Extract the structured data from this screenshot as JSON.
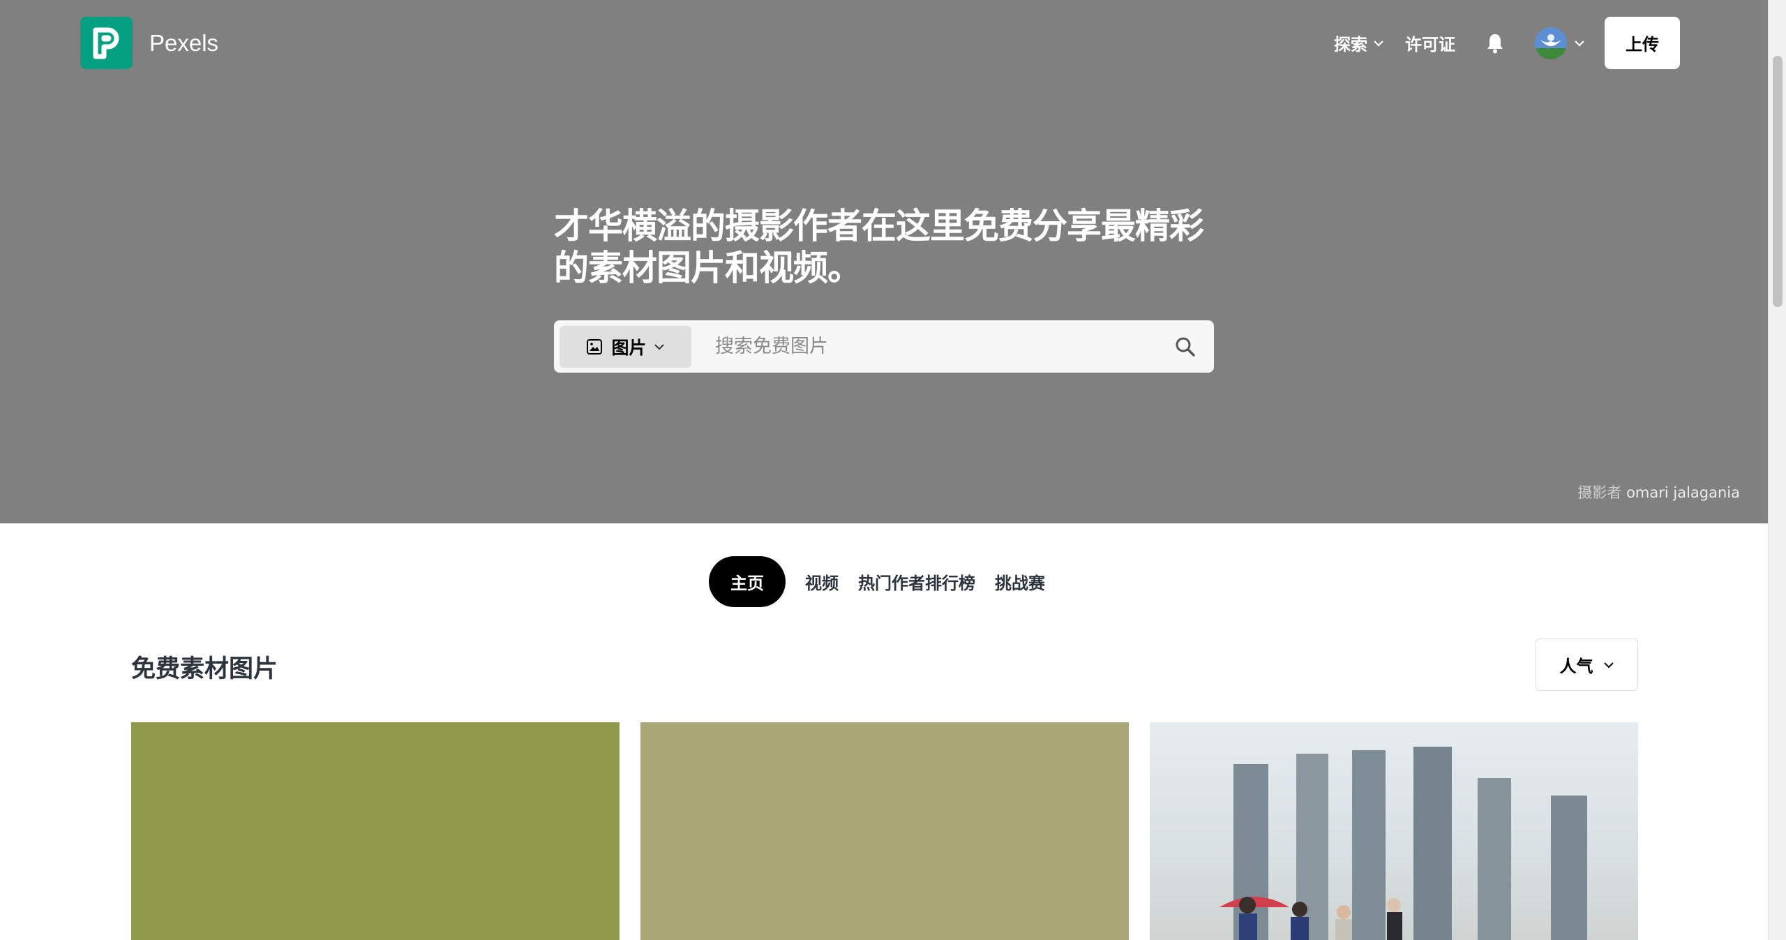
{
  "brand": {
    "name": "Pexels",
    "accent": "#05a081"
  },
  "nav": {
    "explore_label": "探索",
    "license_label": "许可证",
    "upload_label": "上传"
  },
  "hero": {
    "title": "才华横溢的摄影作者在这里免费分享最精彩的素材图片和视频。",
    "search_type_label": "图片",
    "search_placeholder": "搜索免费图片",
    "credit_prefix": "摄影者",
    "credit_name": "omari jalagania"
  },
  "tabs": [
    {
      "label": "主页",
      "active": true
    },
    {
      "label": "视频",
      "active": false
    },
    {
      "label": "热门作者排行榜",
      "active": false
    },
    {
      "label": "挑战赛",
      "active": false
    }
  ],
  "section": {
    "title": "免费素材图片",
    "sort_label": "人气"
  },
  "photos": [
    {
      "color": "#909a4a"
    },
    {
      "color": "#aaa676"
    },
    {
      "color": "#dfe5e8"
    }
  ]
}
